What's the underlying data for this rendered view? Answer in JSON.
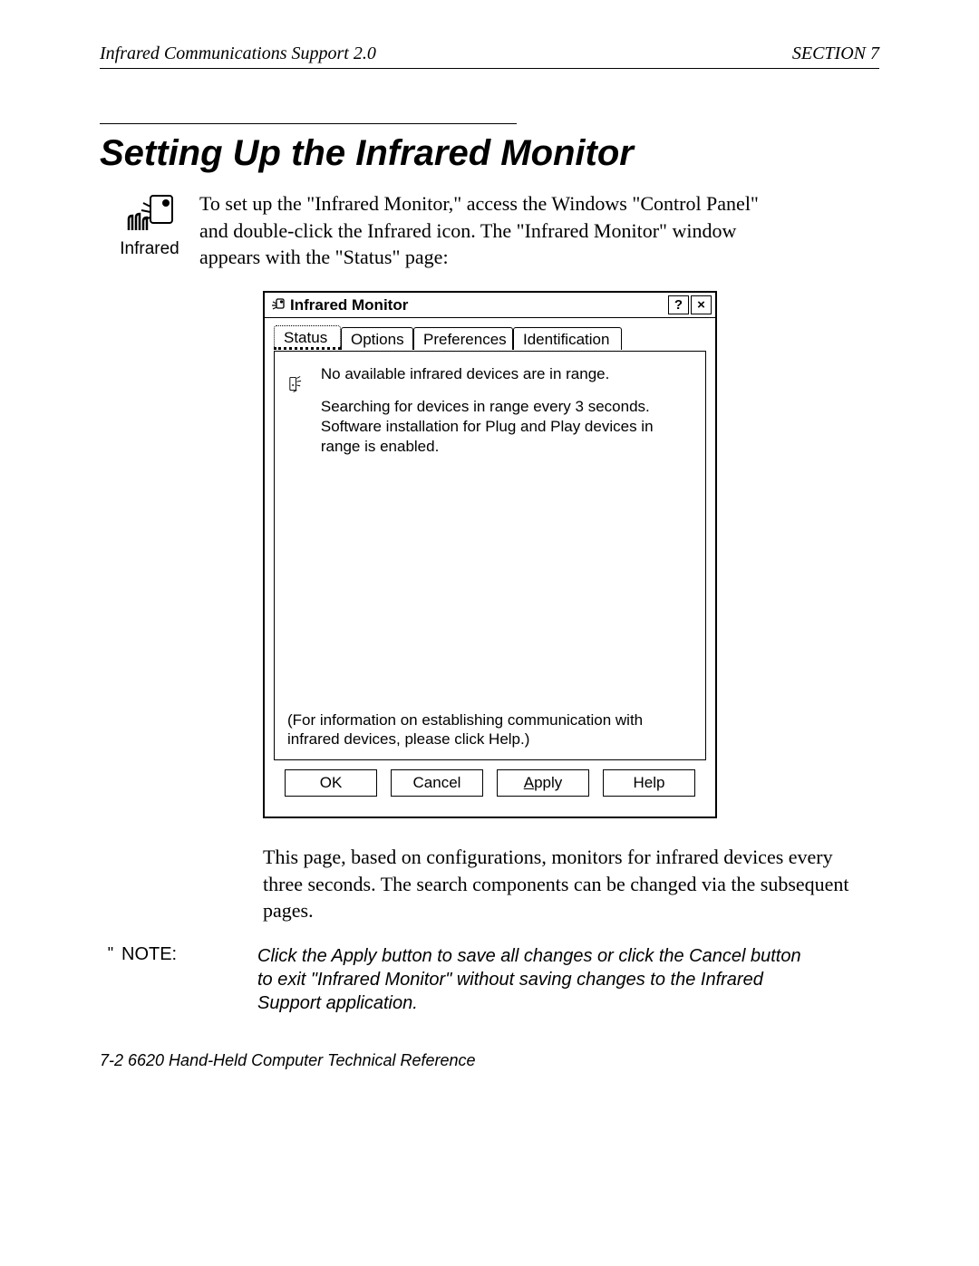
{
  "header": {
    "left": "Infrared Communications Support 2.0",
    "right": "SECTION 7"
  },
  "title": "Setting Up the Infrared Monitor",
  "cp_icon_label": "Infrared",
  "intro": "To set up the \"Infrared Monitor,\" access the Windows \"Control Panel\" and double-click the Infrared icon.  The \"Infrared Monitor\" window appears with the \"Status\" page:",
  "dialog": {
    "title": "Infrared Monitor",
    "help_btn": "?",
    "close_btn": "×",
    "tabs": [
      "Status",
      "Options",
      "Preferences",
      "Identification"
    ],
    "status_line1": "No available infrared devices are in range.",
    "status_line2": "Searching for devices in range every 3 seconds.  Software installation for Plug and Play devices in range is enabled.",
    "help_hint": "(For information on establishing communication with infrared devices, please click Help.)",
    "buttons": {
      "ok": "OK",
      "cancel": "Cancel",
      "apply": "Apply",
      "apply_ul": "A",
      "help": "Help"
    }
  },
  "after": "This page, based on configurations, monitors for infrared devices every three seconds.  The search components can be changed via the subsequent pages.",
  "note_mark": "\"",
  "note_label": "NOTE:",
  "note_body": "Click the Apply button to save all changes or click the Cancel button to exit \"Infrared Monitor\" without saving changes to the Infrared Support application.",
  "footer": "7-2    6620 Hand-Held Computer Technical Reference"
}
